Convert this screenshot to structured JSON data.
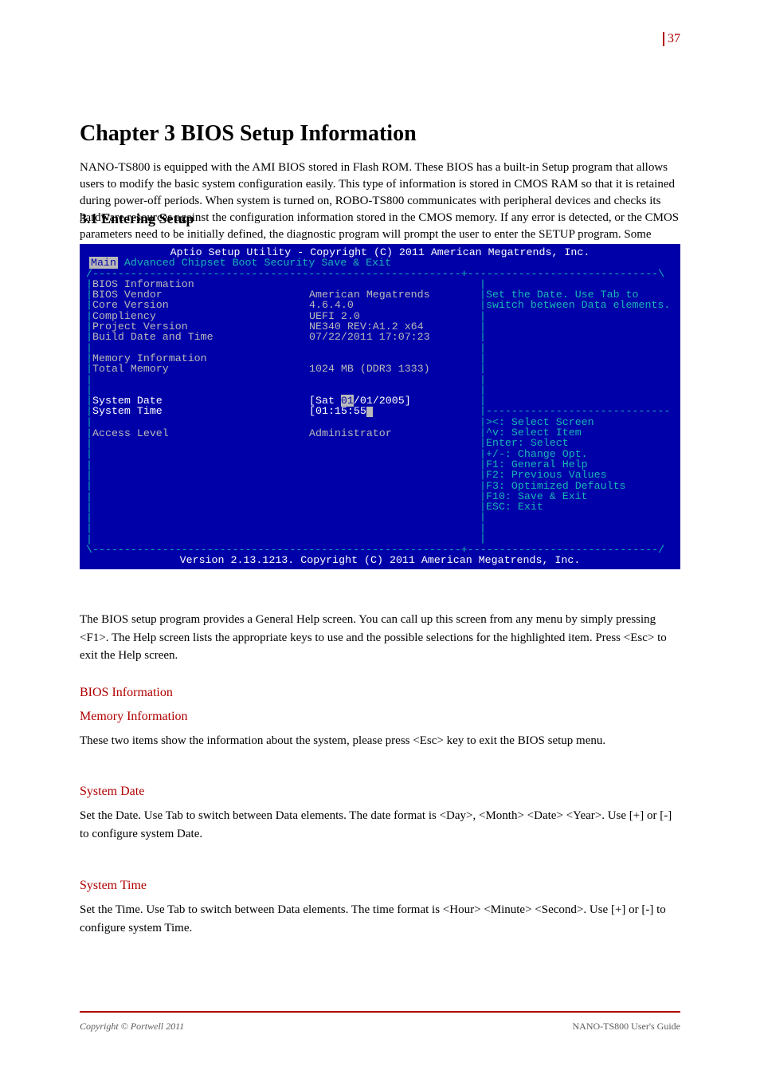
{
  "page_header_number": "37",
  "chapter_title": "Chapter 3 BIOS Setup Information",
  "intro_paragraph": "NANO-TS800 is equipped with the AMI BIOS stored in Flash ROM. These BIOS has a built-in Setup program that allows users to modify the basic system configuration easily. This type of information is stored in CMOS RAM so that it is retained during power-off periods. When system is turned on, ROBO-TS800 communicates with peripheral devices and checks its hardware resources against the configuration information stored in the CMOS memory. If any error is detected, or the CMOS parameters need to be initially defined, the diagnostic program will prompt the user to enter the SETUP program. Some errors are significant enough to abort the start-up.",
  "section_title_1": "3.1 Entering Setup",
  "bios": {
    "title": "Aptio Setup Utility - Copyright (C) 2011 American Megatrends, Inc.",
    "tabs": [
      "Main",
      "Advanced",
      "Chipset",
      "Boot",
      "Security",
      "Save & Exit"
    ],
    "active_tab": "Main",
    "info_section_title": "BIOS Information",
    "rows": [
      {
        "label": "BIOS Vendor",
        "value": "American Megatrends"
      },
      {
        "label": "Core Version",
        "value": "4.6.4.0"
      },
      {
        "label": "Compliency",
        "value": "UEFI 2.0"
      },
      {
        "label": "Project Version",
        "value": "NE340 REV:A1.2 x64"
      },
      {
        "label": "Build Date and Time",
        "value": "07/22/2011 17:07:23"
      }
    ],
    "memory_section_title": "Memory Information",
    "memory_row": {
      "label": "Total Memory",
      "value": "1024 MB (DDR3 1333)"
    },
    "system_date_label": "System Date",
    "system_date_value_prefix": "[Sat ",
    "system_date_highlight": "01",
    "system_date_value_suffix": "/01/2005]",
    "system_time_label": "System Time",
    "system_time_value": "[01:15:55",
    "access_level_label": "Access Level",
    "access_level_value": "Administrator",
    "help_text_1": "Set the Date. Use Tab to",
    "help_text_2": "switch between Data elements.",
    "nav_help": [
      "><: Select Screen",
      "^v: Select Item",
      "Enter: Select",
      "+/-: Change Opt.",
      "F1: General Help",
      "F2: Previous Values",
      "F3: Optimized Defaults",
      "F10: Save & Exit",
      "ESC: Exit"
    ],
    "footer": "Version 2.13.1213. Copyright (C) 2011 American Megatrends, Inc."
  },
  "desc_para_1": "The BIOS setup program provides a General Help screen. You can call up this screen from any menu by simply pressing <F1>. The Help screen lists the appropriate keys to use and the possible selections for the highlighted item. Press <Esc> to exit the Help screen.",
  "sub_heading_1": "BIOS Information",
  "sub_heading_2": "Memory Information",
  "desc_para_2": "These two items show the information about the system, please press <Esc> key to exit the BIOS setup menu.",
  "sub_heading_3": "System Date",
  "desc_para_3": "Set the Date. Use Tab to switch between Data elements. The date format is <Day>, <Month> <Date> <Year>. Use [+] or [-] to configure system Date.",
  "sub_heading_4": "System Time",
  "desc_para_4": "Set the Time. Use Tab to switch between Data elements. The time format is <Hour> <Minute> <Second>. Use [+] or [-] to configure system Time.",
  "footer_left": "Copyright © Portwell 2011",
  "footer_right": "NANO-TS800 User's Guide"
}
